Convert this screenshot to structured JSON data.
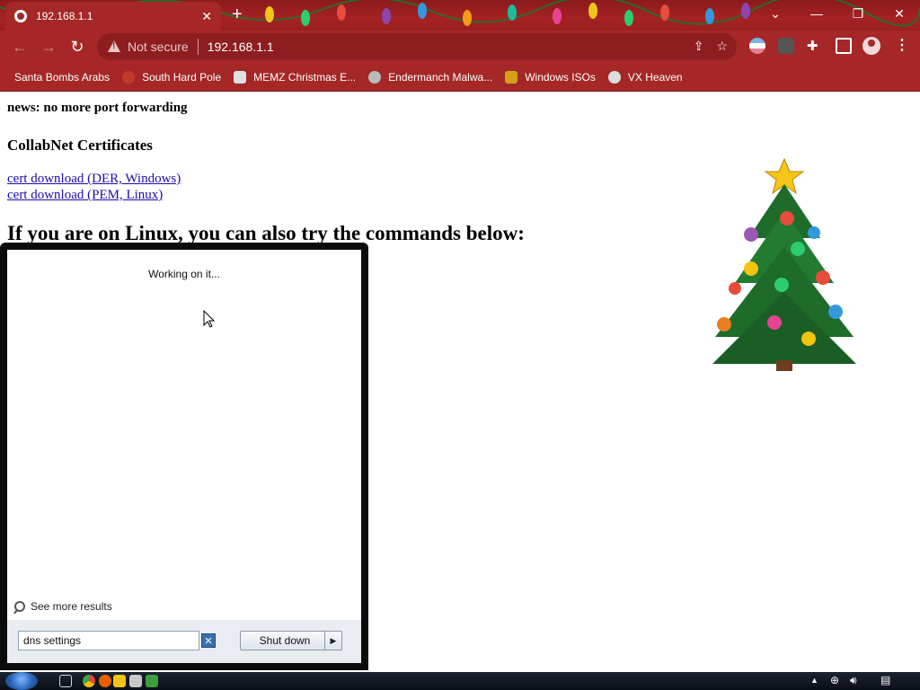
{
  "tab": {
    "title": "192.168.1.1",
    "close": "✕",
    "new_tab": "+"
  },
  "window_controls": {
    "dropdown": "⌄",
    "minimize": "—",
    "restore": "❐",
    "close": "✕"
  },
  "omnibox": {
    "security": "Not secure",
    "url": "192.168.1.1"
  },
  "bookmarks": [
    {
      "label": "Santa Bombs Arabs",
      "color": "#c0392b"
    },
    {
      "label": "South Hard Pole",
      "color": "#ffffff"
    },
    {
      "label": "MEMZ Christmas E...",
      "color": "#e0e0e0"
    },
    {
      "label": "Endermanch Malwa...",
      "color": "#cccccc"
    },
    {
      "label": "Windows ISOs",
      "color": "#d4a017"
    },
    {
      "label": "VX Heaven",
      "color": "#dddddd"
    }
  ],
  "page": {
    "news": "news: no more port forwarding",
    "cert_heading": "CollabNet Certificates",
    "link_der": "cert download (DER, Windows)",
    "link_pem": "cert download (PEM, Linux)",
    "linux_heading": "If you are on Linux, you can also try the commands below:"
  },
  "startmenu": {
    "status": "Working on it...",
    "see_more": "See more results",
    "search_value": "dns settings",
    "shutdown_label": "Shut down"
  },
  "colors": {
    "chrome_red": "#a52727",
    "link": "#1a0dab"
  }
}
